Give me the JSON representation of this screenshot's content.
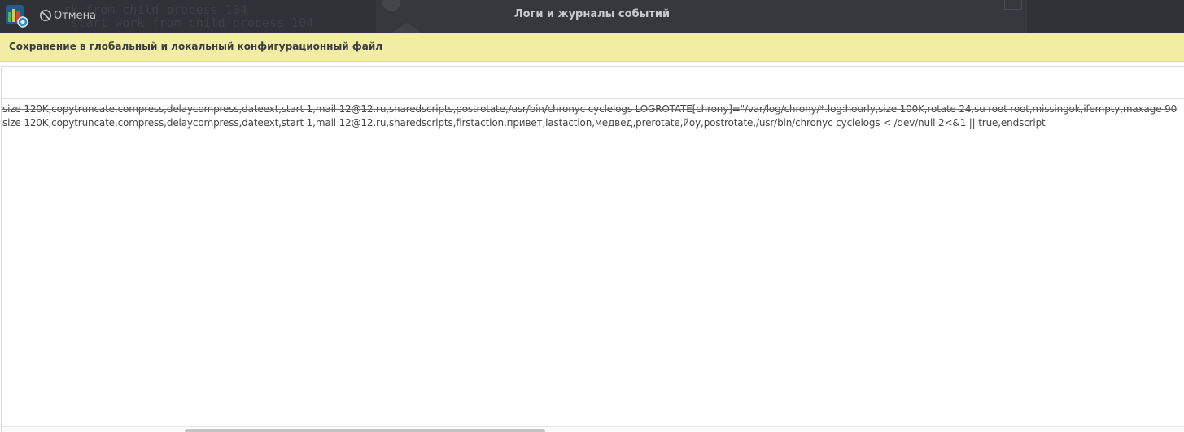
{
  "window": {
    "title": "Логи и журналы событий",
    "logo_icon": "app-logo-icon"
  },
  "toolbar": {
    "cancel_label": "Отмена",
    "cancel_icon": "cancel-icon"
  },
  "banner": {
    "text": "Сохранение в глобальный и локальный конфигурационный файл",
    "background": "#f1eda4"
  },
  "log": {
    "lines": [
      "size 120K,copytruncate,compress,delaycompress,dateext,start 1,mail 12@12.ru,sharedscripts,postrotate,/usr/bin/chronyc cyclelogs LOGROTATE[chrony]=\"/var/log/chrony/*.log:hourly,size 100K,rotate 24,su root root,missingok,ifempty,maxage 90",
      "size 120K,copytruncate,compress,delaycompress,dateext,start 1,mail 12@12.ru,sharedscripts,firstaction,привет,lastaction,медвед,prerotate,йоу,postrotate,/usr/bin/chronyc cyclelogs < /dev/null 2<&1 || true,endscript"
    ]
  },
  "colors": {
    "titlebar": "#2f3237",
    "title_text": "#c8cacd",
    "text": "#464646"
  }
}
